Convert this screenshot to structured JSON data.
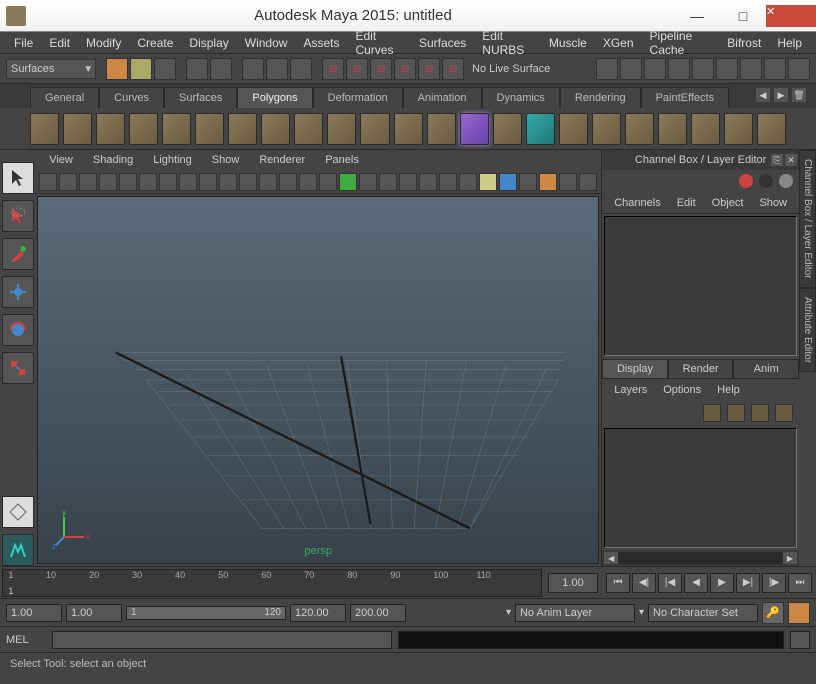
{
  "title": "Autodesk Maya 2015: untitled",
  "menu": [
    "File",
    "Edit",
    "Modify",
    "Create",
    "Display",
    "Window",
    "Assets",
    "Edit Curves",
    "Surfaces",
    "Edit NURBS",
    "Muscle",
    "XGen",
    "Pipeline Cache",
    "Bifrost",
    "Help"
  ],
  "module_combo": "Surfaces",
  "no_live": "No Live Surface",
  "shelf_tabs": [
    "General",
    "Curves",
    "Surfaces",
    "Polygons",
    "Deformation",
    "Animation",
    "Dynamics",
    "Rendering",
    "PaintEffects"
  ],
  "shelf_active": "Polygons",
  "vp_menu": [
    "View",
    "Shading",
    "Lighting",
    "Show",
    "Renderer",
    "Panels"
  ],
  "persp_label": "persp",
  "channel_title": "Channel Box / Layer Editor",
  "channel_menu": [
    "Channels",
    "Edit",
    "Object",
    "Show"
  ],
  "layer_tabs": [
    "Display",
    "Render",
    "Anim"
  ],
  "layer_tab_active": "Display",
  "layer_menu": [
    "Layers",
    "Options",
    "Help"
  ],
  "side_tabs": [
    "Channel Box / Layer Editor",
    "Attribute Editor"
  ],
  "timeline": {
    "ticks": [
      1,
      10,
      20,
      30,
      40,
      50,
      60,
      70,
      80,
      90,
      100,
      110
    ],
    "cur": "1.00"
  },
  "playback": {
    "start": "1.00",
    "rangeStart": "1.00",
    "animStart": "1",
    "animEnd": "120",
    "rangeEnd": "120.00",
    "end": "200.00"
  },
  "anim_layer": "No Anim Layer",
  "char_set": "No Character Set",
  "cmd_lang": "MEL",
  "help_text": "Select Tool: select an object"
}
